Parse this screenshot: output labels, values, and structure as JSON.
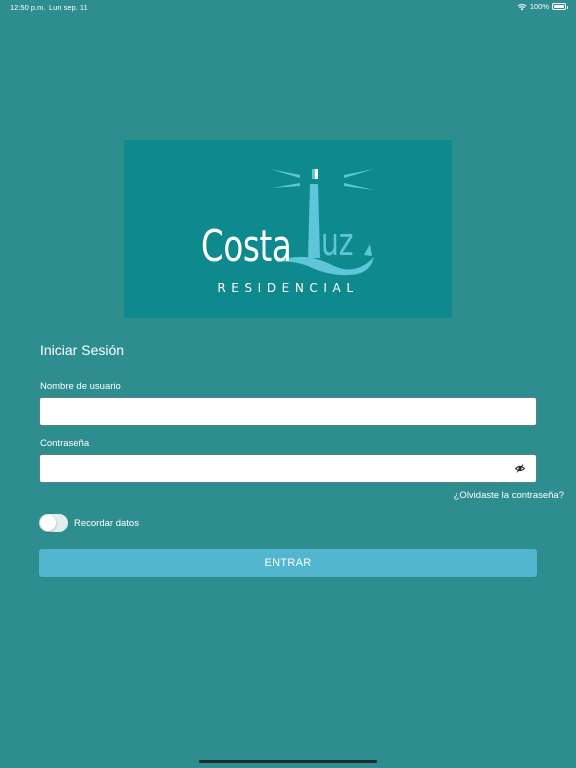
{
  "status_bar": {
    "time": "12:50 p.m.",
    "date": "Lun sep. 11",
    "battery": "100%",
    "icons": [
      "wifi-icon",
      "battery-icon"
    ]
  },
  "logo": {
    "brand_left": "Costa",
    "brand_right": "uz",
    "tagline": "RESIDENCIAL",
    "colors": {
      "background": "#0e8a8e",
      "text": "#ffffff",
      "accent": "#5ec6d8"
    }
  },
  "form": {
    "title": "Iniciar Sesión",
    "username": {
      "label": "Nombre de usuario",
      "value": "",
      "placeholder": ""
    },
    "password": {
      "label": "Contraseña",
      "value": "",
      "placeholder": "",
      "icon": "eye-icon"
    },
    "forgot_link": "¿Olvidaste la contraseña?",
    "remember": {
      "label": "Recordar datos",
      "on": false
    },
    "submit_label": "ENTRAR"
  },
  "colors": {
    "background": "#2d8d8f",
    "button": "#52b6cf",
    "text": "#ffffff"
  }
}
